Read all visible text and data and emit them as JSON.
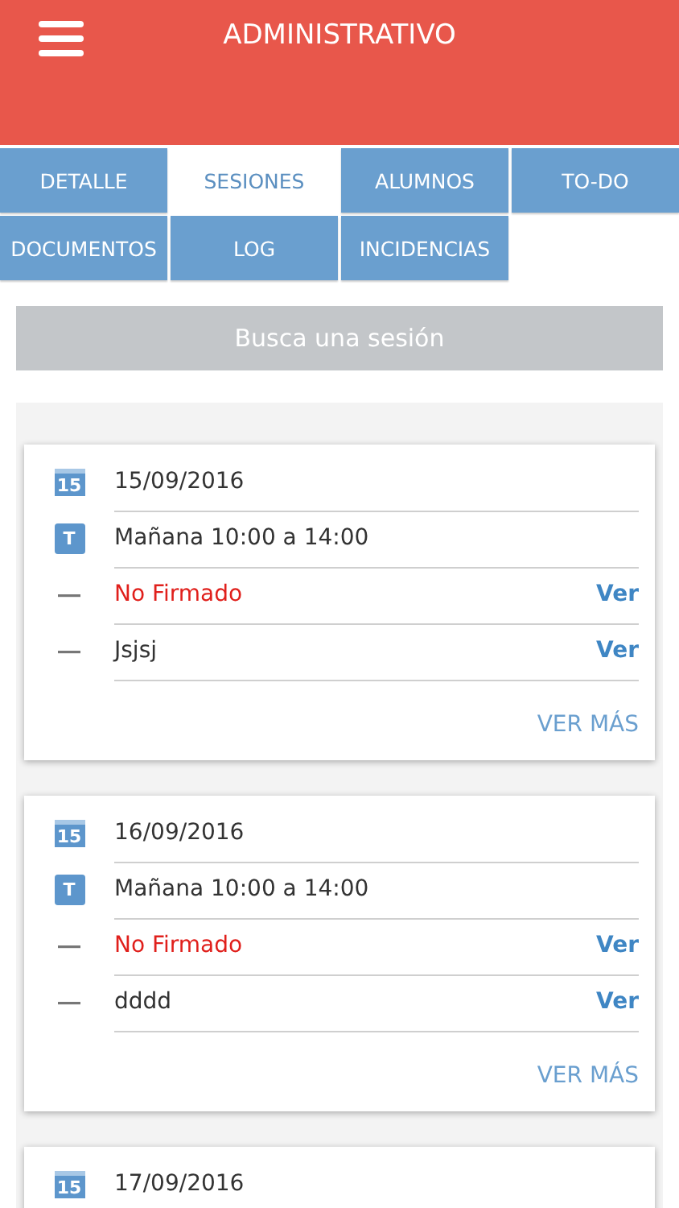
{
  "header": {
    "title": "ADMINISTRATIVO"
  },
  "tabs": [
    {
      "label": "DETALLE",
      "selected": false
    },
    {
      "label": "SESIONES",
      "selected": true
    },
    {
      "label": "ALUMNOS",
      "selected": false
    },
    {
      "label": "TO-DO",
      "selected": false
    },
    {
      "label": "DOCUMENTOS",
      "selected": false
    },
    {
      "label": "LOG",
      "selected": false
    },
    {
      "label": "INCIDENCIAS",
      "selected": false
    }
  ],
  "search": {
    "placeholder": "Busca una sesión"
  },
  "sessions": [
    {
      "calendar_icon_label": "15",
      "date": "15/09/2016",
      "time_icon_label": "T",
      "time": "Mañana 10:00 a 14:00",
      "items": [
        {
          "kind": "unsigned",
          "text": "No Firmado",
          "link": "Ver"
        },
        {
          "kind": "note",
          "text": "Jsjsj",
          "link": "Ver"
        }
      ],
      "more": "VER MÁS"
    },
    {
      "calendar_icon_label": "15",
      "date": "16/09/2016",
      "time_icon_label": "T",
      "time": "Mañana 10:00 a 14:00",
      "items": [
        {
          "kind": "unsigned",
          "text": "No Firmado",
          "link": "Ver"
        },
        {
          "kind": "note",
          "text": "dddd",
          "link": "Ver"
        }
      ],
      "more": "VER MÁS"
    },
    {
      "calendar_icon_label": "15",
      "date": "17/09/2016"
    }
  ]
}
